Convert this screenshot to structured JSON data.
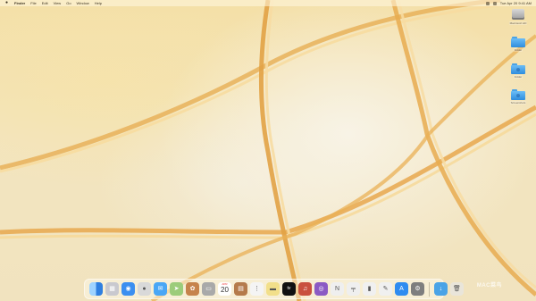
{
  "menubar": {
    "apple_icon": "apple-logo-icon",
    "items": [
      "Finder",
      "File",
      "Edit",
      "View",
      "Go",
      "Window",
      "Help"
    ],
    "clock": "Tue Apr 20  9:41 AM"
  },
  "desktop_icons": [
    {
      "kind": "drive",
      "label": "Macintosh HD",
      "icon": "hard-drive-icon"
    },
    {
      "kind": "folder",
      "label": "Folder",
      "icon": "folder-icon"
    },
    {
      "kind": "folder",
      "label": "Folder",
      "icon": "folder-icon"
    },
    {
      "kind": "folder",
      "label": "Screenshots",
      "icon": "folder-icon"
    }
  ],
  "dock": {
    "apps": [
      {
        "name": "finder",
        "icon": "finder-icon",
        "bg": "linear-gradient(90deg,#9fd3ff 50%,#2f7fe0 50%)",
        "glyph": "",
        "running": true
      },
      {
        "name": "launchpad",
        "icon": "launchpad-icon",
        "bg": "#c9c9cf",
        "glyph": "▦"
      },
      {
        "name": "safari",
        "icon": "safari-icon",
        "bg": "#3b8ff0",
        "glyph": "◉"
      },
      {
        "name": "messages",
        "icon": "messages-icon",
        "bg": "#d9d9d9",
        "glyph": "●"
      },
      {
        "name": "mail",
        "icon": "mail-icon",
        "bg": "#4aa7f5",
        "glyph": "✉"
      },
      {
        "name": "maps",
        "icon": "maps-icon",
        "bg": "#9ccc7a",
        "glyph": "➤"
      },
      {
        "name": "photos",
        "icon": "photos-icon",
        "bg": "#c6834b",
        "glyph": "✿"
      },
      {
        "name": "facetime",
        "icon": "facetime-icon",
        "bg": "#a9a9a9",
        "glyph": "▭"
      },
      {
        "name": "calendar",
        "icon": "calendar-icon",
        "bg": "#ffffff",
        "glyph": "",
        "month": "APR",
        "day": "20"
      },
      {
        "name": "contacts",
        "icon": "contacts-icon",
        "bg": "#b57b4b",
        "glyph": "▤"
      },
      {
        "name": "reminders",
        "icon": "reminders-icon",
        "bg": "#f4f4f4",
        "glyph": "⋮"
      },
      {
        "name": "notes",
        "icon": "notes-icon",
        "bg": "#f2df8a",
        "glyph": "▬"
      },
      {
        "name": "tv",
        "icon": "apple-tv-icon",
        "bg": "#111111",
        "glyph": "tv"
      },
      {
        "name": "music",
        "icon": "music-icon",
        "bg": "#c9513e",
        "glyph": "♫"
      },
      {
        "name": "podcasts",
        "icon": "podcasts-icon",
        "bg": "#8b5bc4",
        "glyph": "◎"
      },
      {
        "name": "news",
        "icon": "news-icon",
        "bg": "#efefef",
        "glyph": "N"
      },
      {
        "name": "keynote",
        "icon": "keynote-icon",
        "bg": "#efefef",
        "glyph": "╤"
      },
      {
        "name": "numbers",
        "icon": "numbers-icon",
        "bg": "#f0f0f0",
        "glyph": "▮"
      },
      {
        "name": "pages",
        "icon": "pages-icon",
        "bg": "#f0f0f0",
        "glyph": "✎"
      },
      {
        "name": "app-store",
        "icon": "app-store-icon",
        "bg": "#2f8cf0",
        "glyph": "A"
      },
      {
        "name": "system-preferences",
        "icon": "system-preferences-icon",
        "bg": "#7e7e7e",
        "glyph": "⚙"
      }
    ],
    "right_items": [
      {
        "name": "downloads",
        "icon": "downloads-folder-icon",
        "bg": "#4aa3e6",
        "glyph": "↓"
      },
      {
        "name": "trash",
        "icon": "trash-icon",
        "bg": "rgba(230,230,230,0.7)",
        "glyph": "🗑"
      }
    ]
  },
  "watermark": "MAC菜鸟"
}
